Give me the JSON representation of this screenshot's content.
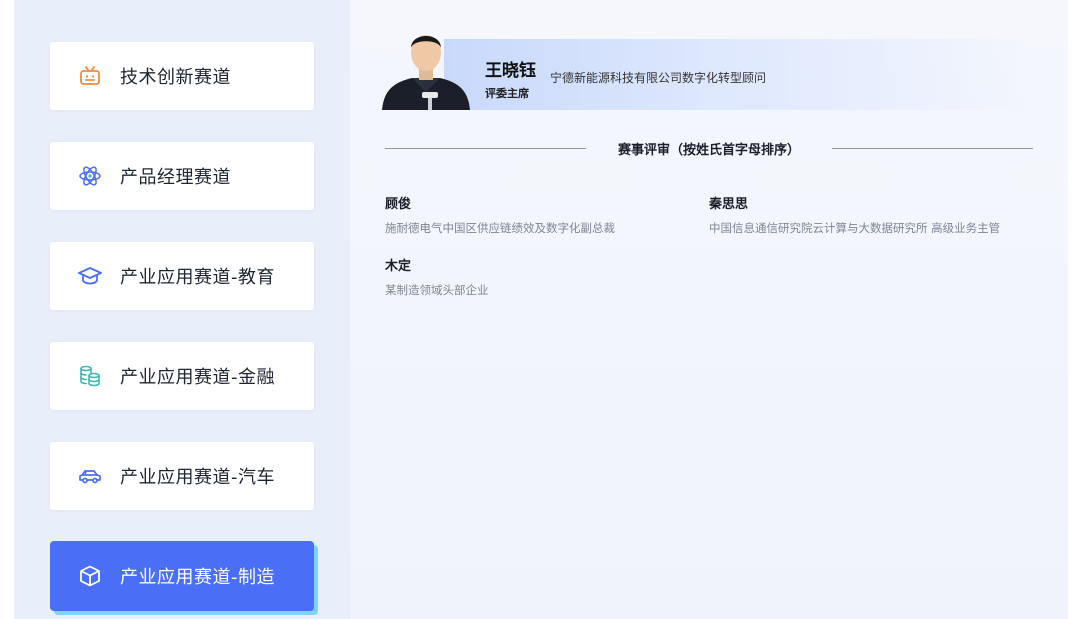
{
  "sidebar": {
    "tracks": [
      {
        "label": "技术创新赛道",
        "icon": "robot-icon",
        "active": false
      },
      {
        "label": "产品经理赛道",
        "icon": "atom-icon",
        "active": false
      },
      {
        "label": "产业应用赛道-教育",
        "icon": "graduation-cap-icon",
        "active": false
      },
      {
        "label": "产业应用赛道-金融",
        "icon": "coins-icon",
        "active": false
      },
      {
        "label": "产业应用赛道-汽车",
        "icon": "car-icon",
        "active": false
      },
      {
        "label": "产业应用赛道-制造",
        "icon": "cube-icon",
        "active": true
      }
    ]
  },
  "main": {
    "chair": {
      "name": "王晓钰",
      "role": "评委主席",
      "org": "宁德新能源科技有限公司数字化转型顾问"
    },
    "section_title": "赛事评审（按姓氏首字母排序）",
    "judges": [
      {
        "name": "顾俊",
        "org": "施耐德电气中国区供应链绩效及数字化副总裁"
      },
      {
        "name": "秦思思",
        "org": "中国信息通信研究院云计算与大数据研究所 高级业务主管"
      },
      {
        "name": "木定",
        "org": "某制造领域头部企业"
      }
    ]
  },
  "colors": {
    "accent": "#4a6ef5",
    "accent_shadow": "#7fd3f7",
    "robot_icon": "#f08a3c",
    "teal_icon": "#3fb7b0",
    "blue_icon": "#4a6ef5"
  }
}
